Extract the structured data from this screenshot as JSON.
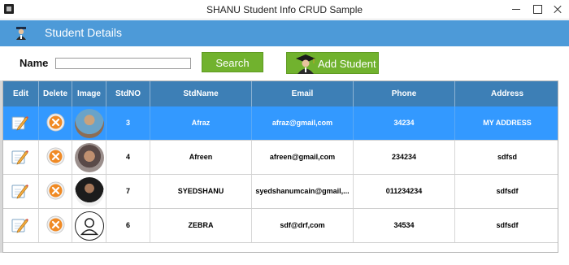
{
  "window": {
    "title": "SHANU Student Info CRUD Sample"
  },
  "header": {
    "title": "Student Details",
    "icon": "student-icon"
  },
  "search": {
    "label": "Name",
    "value": "",
    "button_label": "Search"
  },
  "add_button": {
    "label": "Add Student",
    "icon": "graduate-icon"
  },
  "colors": {
    "header_band": "#4d9ad8",
    "grid_header": "#3d7fb6",
    "button_green": "#71b22e",
    "selected_row": "#3399ff"
  },
  "grid": {
    "columns": [
      "Edit",
      "Delete",
      "Image",
      "StdNO",
      "StdName",
      "Email",
      "Phone",
      "Address"
    ],
    "rows": [
      {
        "stdno": "3",
        "name": "Afraz",
        "email": "afraz@gmail,com",
        "phone": "34234",
        "address": "MY ADDRESS",
        "image": "photo",
        "selected": true
      },
      {
        "stdno": "4",
        "name": "Afreen",
        "email": "afreen@gmail,com",
        "phone": "234234",
        "address": "sdfsd",
        "image": "photo",
        "selected": false
      },
      {
        "stdno": "7",
        "name": "SYEDSHANU",
        "email": "syedshanumcain@gmail,...",
        "phone": "011234234",
        "address": "sdfsdf",
        "image": "photo",
        "selected": false
      },
      {
        "stdno": "6",
        "name": "ZEBRA",
        "email": "sdf@drf,com",
        "phone": "34534",
        "address": "sdfsdf",
        "image": "user-placeholder-icon",
        "selected": false
      }
    ]
  }
}
